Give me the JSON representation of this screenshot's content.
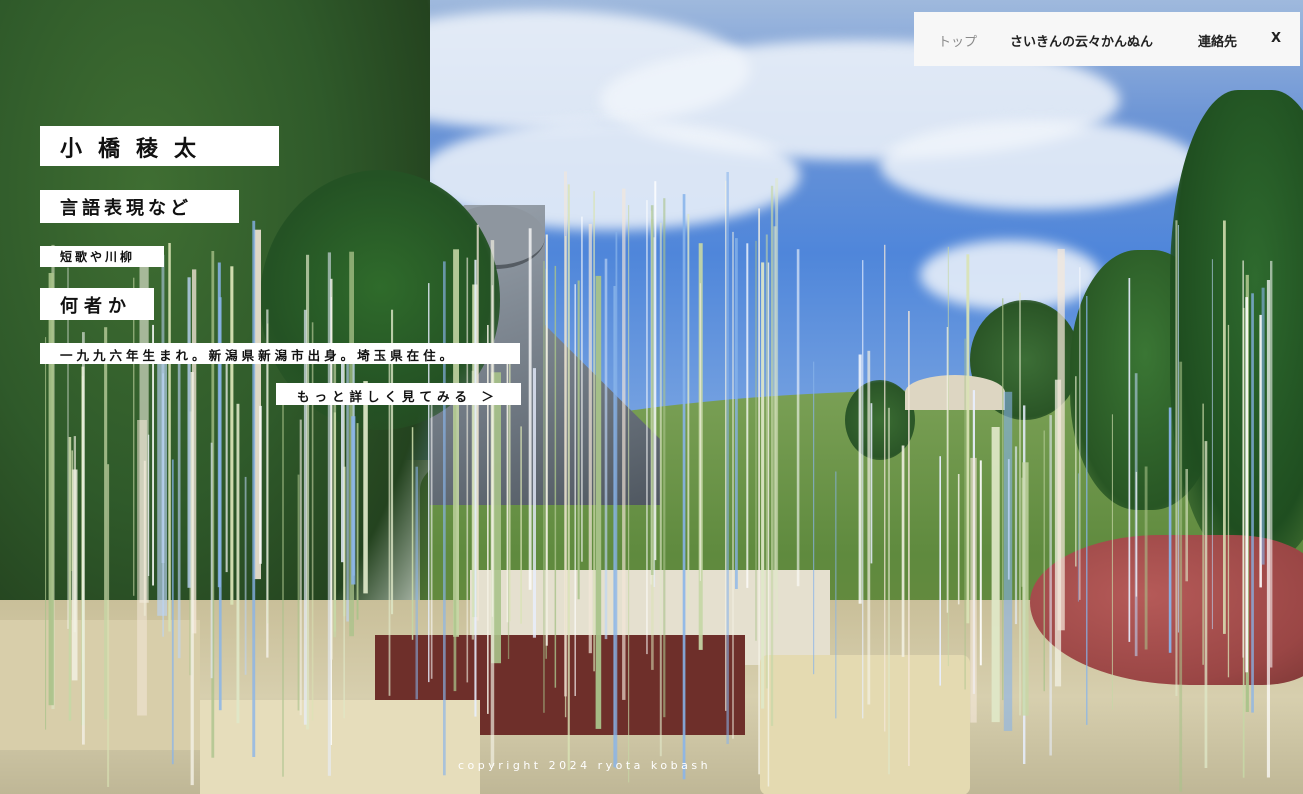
{
  "nav": {
    "items": [
      {
        "label": "トップ",
        "current": true
      },
      {
        "label": "さいきんの云々かんぬん",
        "current": false
      },
      {
        "label": "連絡先",
        "current": false
      }
    ],
    "close_label": "X"
  },
  "hero": {
    "name": "小橋稜太",
    "heading1": "言語表現など",
    "sub": "短歌や川柳",
    "heading2": "何者か",
    "bio": "一九九六年生まれ。新潟県新潟市出身。埼玉県在住。",
    "more_link": "もっと詳しく見てみる ＞"
  },
  "footer": {
    "copyright": "copyright 2024 ryota kobash"
  },
  "colors": {
    "label_bg": "#ffffff",
    "nav_bg": "#f7f7f7",
    "nav_current": "#8a8a8a",
    "text": "#111111"
  }
}
